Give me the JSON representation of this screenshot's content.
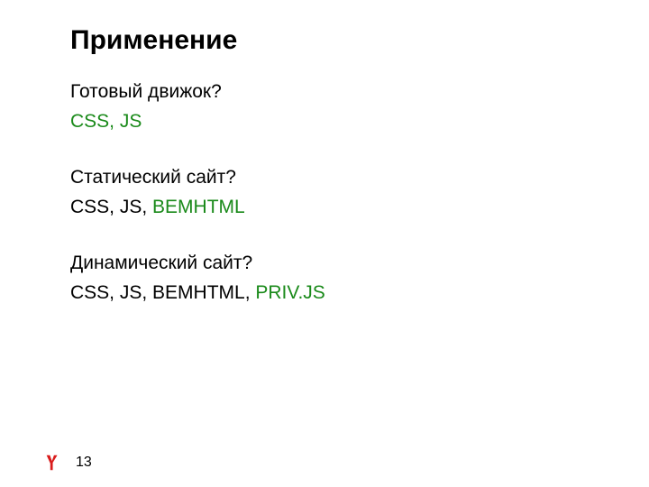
{
  "title": "Применение",
  "blocks": [
    {
      "question": "Готовый движок?",
      "answer_parts": [
        {
          "text": "CSS, JS",
          "green": true
        }
      ]
    },
    {
      "question": "Статический сайт?",
      "answer_parts": [
        {
          "text": "CSS, JS, ",
          "green": false
        },
        {
          "text": "BEMHTML",
          "green": true
        }
      ]
    },
    {
      "question": "Динамический сайт?",
      "answer_parts": [
        {
          "text": "CSS, JS, BEMHTML, ",
          "green": false
        },
        {
          "text": "PRIV.JS",
          "green": true
        }
      ]
    }
  ],
  "page_number": "13"
}
